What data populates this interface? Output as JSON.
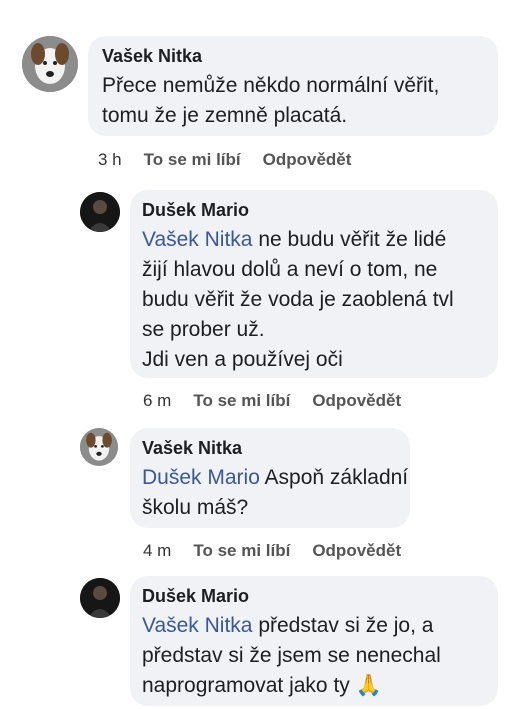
{
  "comments": [
    {
      "author": "Vašek Nitka",
      "lines": [
        "Přece nemůže někdo normální věřit,",
        "tomu že je zemně placatá."
      ],
      "time": "3 h",
      "like": "To se mi líbí",
      "reply": "Odpovědět"
    },
    {
      "author": "Dušek Mario",
      "mention": "Vašek Nitka",
      "first_line_rest": " ne budu věřit že lidé",
      "lines": [
        "žijí hlavou dolů a neví o tom,  ne",
        "budu věřit že voda je zaoblená tvl",
        "se prober už.",
        "Jdi ven a používej oči"
      ],
      "time": "6 m",
      "like": "To se mi líbí",
      "reply": "Odpovědět"
    },
    {
      "author": "Vašek Nitka",
      "mention": "Dušek Mario",
      "first_line_rest": " Aspoň základní",
      "lines": [
        "školu máš?"
      ],
      "time": "4 m",
      "like": "To se mi líbí",
      "reply": "Odpovědět"
    },
    {
      "author": "Dušek Mario",
      "mention": "Vašek Nitka",
      "first_line_rest": " představ si že jo,  a",
      "lines": [
        "představ si že jsem se nenechal",
        "naprogramovat jako ty"
      ],
      "emoji": "🙏",
      "emoji_name": "praying-hands-emoji"
    }
  ]
}
